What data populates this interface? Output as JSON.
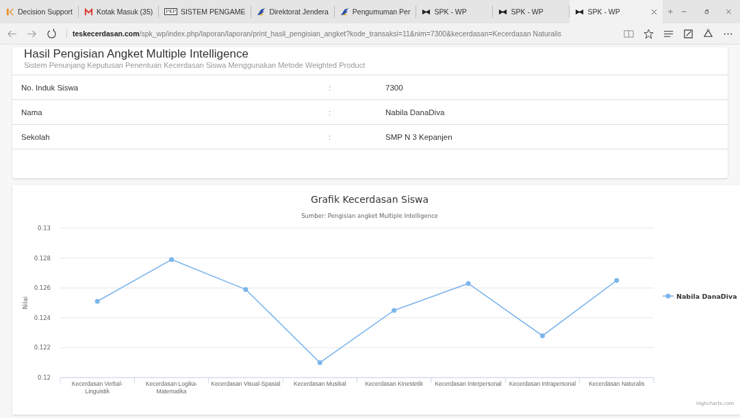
{
  "browser": {
    "tabs": [
      {
        "title": "Decision Support",
        "kind": "k-logo",
        "selected": false
      },
      {
        "title": "Kotak Masuk (35)",
        "kind": "mail",
        "selected": false
      },
      {
        "title": "SISTEM PENGAME",
        "kind": "badge",
        "badge": "PKP",
        "selected": false
      },
      {
        "title": "Direktorat Jendera",
        "kind": "wing",
        "selected": false
      },
      {
        "title": "Pengumuman Per",
        "kind": "wing",
        "selected": false
      },
      {
        "title": "SPK - WP",
        "kind": "bowtie",
        "selected": false
      },
      {
        "title": "SPK - WP",
        "kind": "bowtie",
        "selected": false
      },
      {
        "title": "SPK - WP",
        "kind": "bowtie",
        "selected": true
      }
    ],
    "url": {
      "domain": "teskecerdasan.com",
      "path": "/spk_wp/index.php/laporan/laporan/print_hasil_pengisian_angket?kode_transaksi=11&nim=7300&kecerdasan=Kecerdasan Naturalis"
    }
  },
  "header": {
    "title": "Hasil Pengisian Angket Multiple Intelligence",
    "subtitle": "Sistem Penunjang Keputusan Penentuan Kecerdasan Siswa Menggunakan Metode Weighted Product"
  },
  "profile": [
    {
      "label": "No. Induk Siswa",
      "separator": ":",
      "value": "7300"
    },
    {
      "label": "Nama",
      "separator": ":",
      "value": "Nabila DanaDiva"
    },
    {
      "label": "Sekolah",
      "separator": ":",
      "value": "SMP N 3 Kepanjen"
    }
  ],
  "chart": {
    "credit": "Highcharts.com",
    "chart_data": {
      "type": "line",
      "title": "Grafik Kecerdasan Siswa",
      "subtitle": "Sumber: Pengisian angket Multiple Intelligence",
      "ylabel": "Nilai",
      "categories": [
        "Kecerdasan Verbal-Linguistik",
        "Kecerdasan Logika-Matematika",
        "Kecerdasan Visual-Spasial",
        "Kecerdasan Musikal",
        "Kecerdasan Kinestetik",
        "Kecerdasan Interpersonal",
        "Kecerdasan Intrapersonal",
        "Kecerdasan Naturalis"
      ],
      "series": [
        {
          "name": "Nabila DanaDiva",
          "color": "#7cb5ec",
          "marker": true,
          "values": [
            0.1251,
            0.1279,
            0.1259,
            0.121,
            0.1245,
            0.1263,
            0.1228,
            0.1265
          ]
        }
      ],
      "ylim": [
        0.12,
        0.13
      ],
      "grid": true,
      "yticks": [
        {
          "value": 0.12,
          "label": "0.12"
        },
        {
          "value": 0.122,
          "label": "0.122"
        },
        {
          "value": 0.124,
          "label": "0.124"
        },
        {
          "value": 0.126,
          "label": "0.126"
        },
        {
          "value": 0.128,
          "label": "0.128"
        },
        {
          "value": 0.13,
          "label": "0.13"
        }
      ]
    }
  }
}
